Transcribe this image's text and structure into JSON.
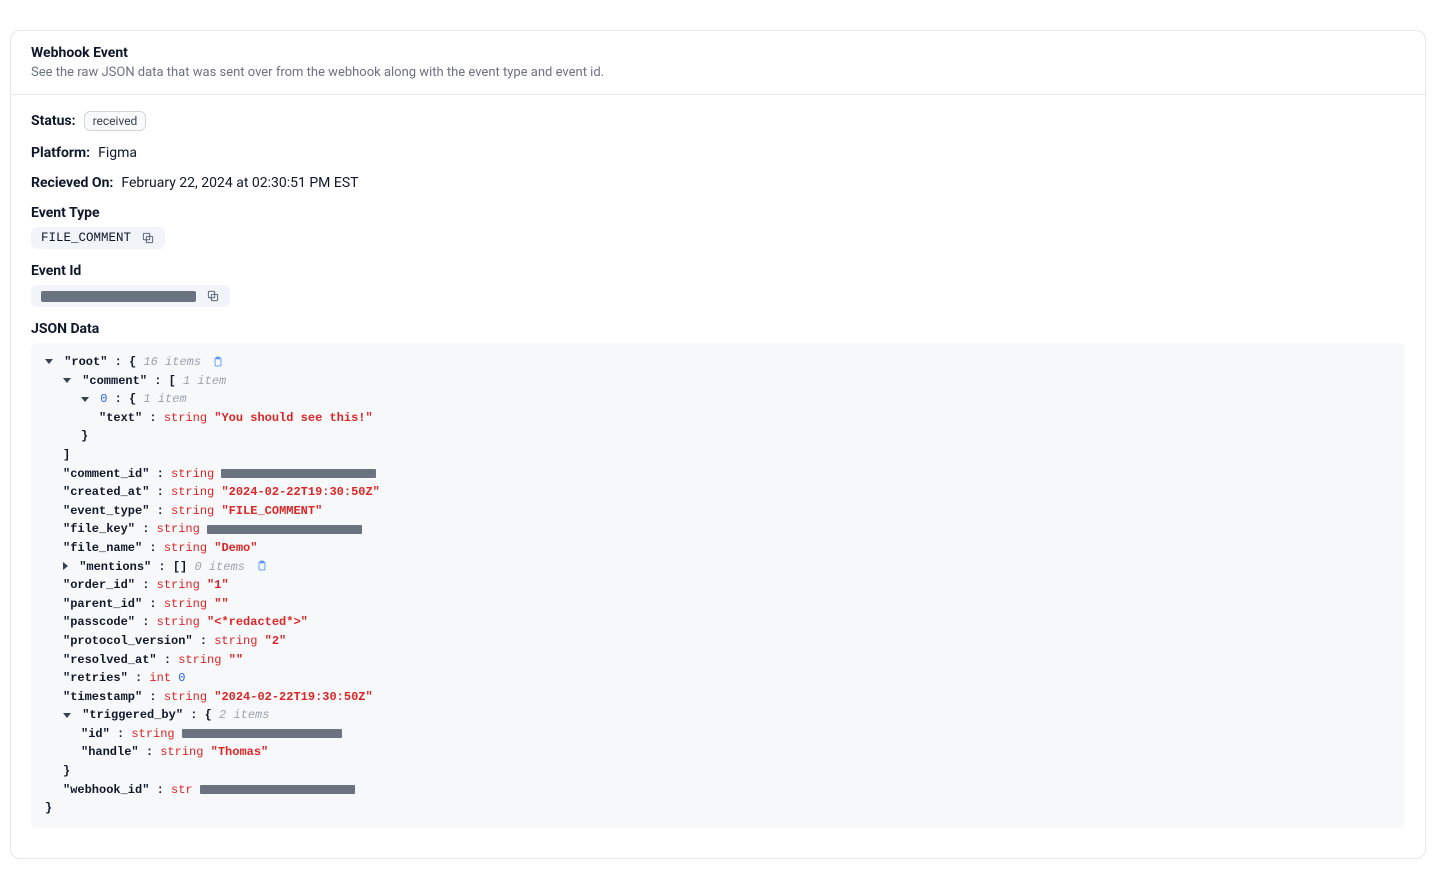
{
  "header": {
    "title": "Webhook Event",
    "subtitle": "See the raw JSON data that was sent over from the webhook along with the event type and event id."
  },
  "status": {
    "label": "Status:",
    "value": "received"
  },
  "platform": {
    "label": "Platform:",
    "value": "Figma"
  },
  "received_on": {
    "label": "Recieved On:",
    "value": "February 22, 2024 at 02:30:51 PM EST"
  },
  "event_type": {
    "label": "Event Type",
    "value": "FILE_COMMENT"
  },
  "event_id": {
    "label": "Event Id"
  },
  "json_section": {
    "label": "JSON Data"
  },
  "json": {
    "root_key": "\"root\"",
    "root_count": "16 items",
    "comment_key": "\"comment\"",
    "comment_count": "1 item",
    "comment_index": "0",
    "comment_index_count": "1 item",
    "comment_text_key": "\"text\"",
    "comment_text_type": "string",
    "comment_text_value": "\"You should see this!\"",
    "comment_id_key": "\"comment_id\"",
    "comment_id_type": "string",
    "created_at_key": "\"created_at\"",
    "created_at_type": "string",
    "created_at_value": "\"2024-02-22T19:30:50Z\"",
    "event_type_key": "\"event_type\"",
    "event_type_type": "string",
    "event_type_value": "\"FILE_COMMENT\"",
    "file_key_key": "\"file_key\"",
    "file_key_type": "string",
    "file_name_key": "\"file_name\"",
    "file_name_type": "string",
    "file_name_value": "\"Demo\"",
    "mentions_key": "\"mentions\"",
    "mentions_count": "0 items",
    "order_id_key": "\"order_id\"",
    "order_id_type": "string",
    "order_id_value": "\"1\"",
    "parent_id_key": "\"parent_id\"",
    "parent_id_type": "string",
    "parent_id_value": "\"\"",
    "passcode_key": "\"passcode\"",
    "passcode_type": "string",
    "passcode_value": "\"<*redacted*>\"",
    "protocol_version_key": "\"protocol_version\"",
    "protocol_version_type": "string",
    "protocol_version_value": "\"2\"",
    "resolved_at_key": "\"resolved_at\"",
    "resolved_at_type": "string",
    "resolved_at_value": "\"\"",
    "retries_key": "\"retries\"",
    "retries_type": "int",
    "retries_value": "0",
    "timestamp_key": "\"timestamp\"",
    "timestamp_type": "string",
    "timestamp_value": "\"2024-02-22T19:30:50Z\"",
    "triggered_by_key": "\"triggered_by\"",
    "triggered_by_count": "2 items",
    "tb_id_key": "\"id\"",
    "tb_id_type": "string",
    "tb_handle_key": "\"handle\"",
    "tb_handle_type": "string",
    "tb_handle_value": "\"Thomas\"",
    "webhook_id_key": "\"webhook_id\"",
    "webhook_id_type": "str"
  }
}
